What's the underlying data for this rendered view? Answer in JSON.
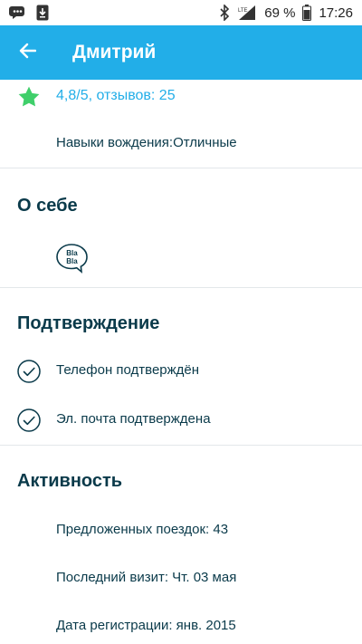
{
  "status_bar": {
    "battery": "69 %",
    "time": "17:26",
    "network": "LTE"
  },
  "app_bar": {
    "title": "Дмитрий"
  },
  "profile": {
    "rating_text": "4,8/5, отзывов: 25",
    "driving_skill": "Навыки вождения:Отличные"
  },
  "about": {
    "heading": "О себе",
    "chattiness_icon_text": "Bla Bla"
  },
  "verification": {
    "heading": "Подтверждение",
    "items": [
      {
        "label": "Телефон подтверждён"
      },
      {
        "label": "Эл. почта подтверждена"
      }
    ]
  },
  "activity": {
    "heading": "Активность",
    "items": [
      {
        "label": "Предложенных поездок: 43"
      },
      {
        "label": "Последний визит: Чт. 03 мая"
      },
      {
        "label": "Дата регистрации: янв. 2015"
      }
    ]
  },
  "colors": {
    "accent": "#22aee8",
    "star": "#3fcf6a",
    "text": "#0a3a4a"
  }
}
